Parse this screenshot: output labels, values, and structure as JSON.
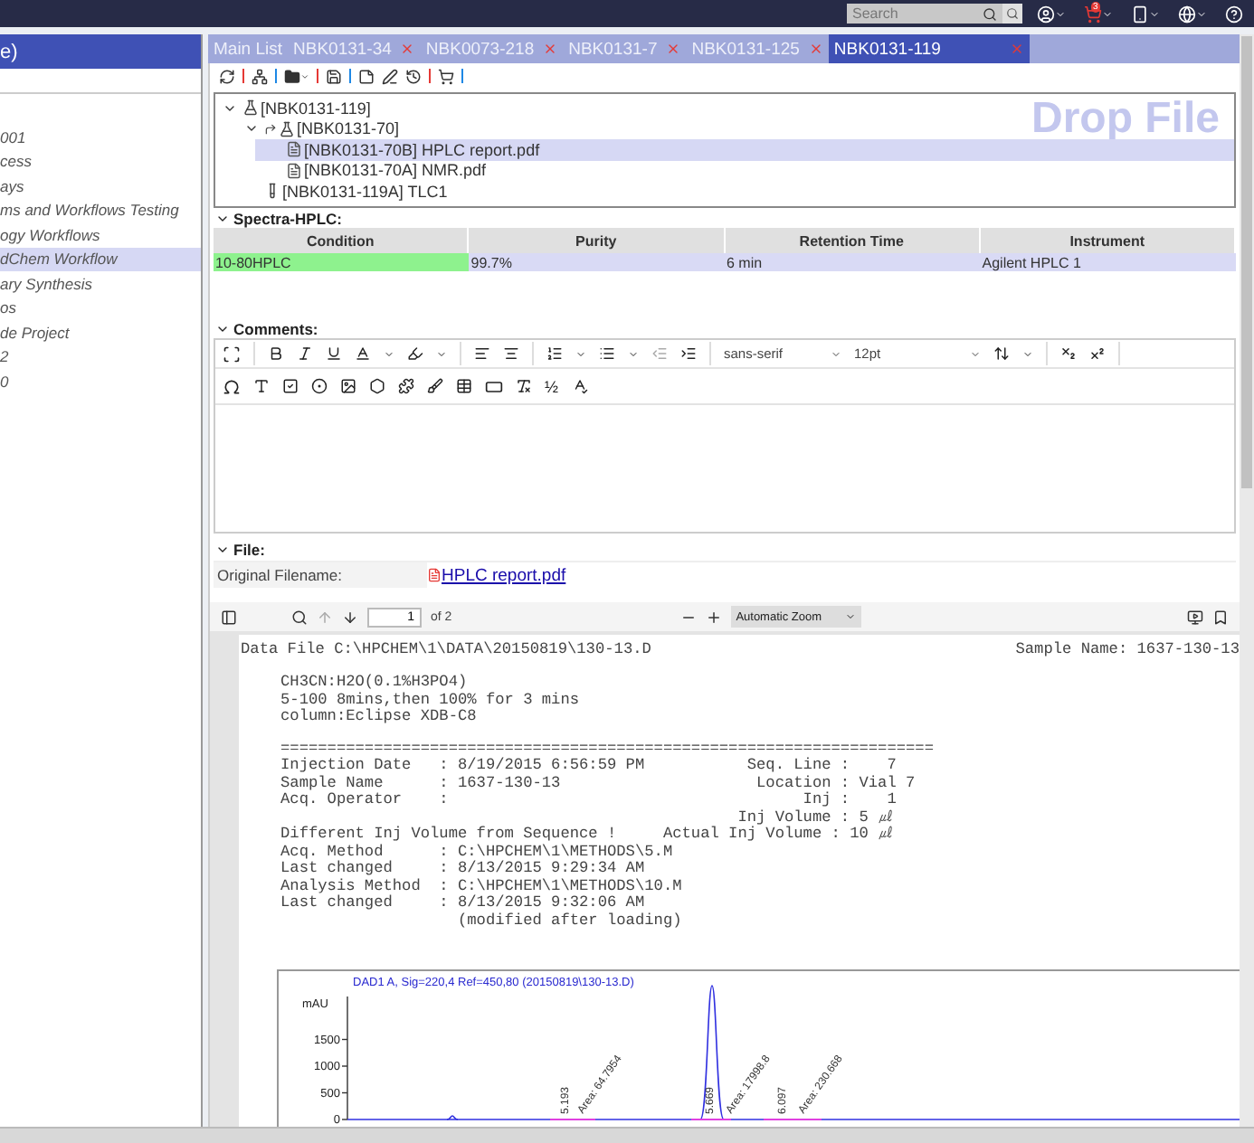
{
  "top_bar": {
    "search": {
      "placeholder": "Search"
    },
    "cart_badge": "3"
  },
  "sidebar": {
    "title": "e)",
    "items": [
      {
        "label": "001",
        "selected": false
      },
      {
        "label": "cess",
        "selected": false
      },
      {
        "label": "ays",
        "selected": false
      },
      {
        "label": "ms and Workflows Testing",
        "selected": false
      },
      {
        "label": "ogy Workflows",
        "selected": false
      },
      {
        "label": "dChem Workflow",
        "selected": true
      },
      {
        "label": "ary Synthesis",
        "selected": false
      },
      {
        "label": "os",
        "selected": false
      },
      {
        "label": "de Project",
        "selected": false
      },
      {
        "label": "2",
        "selected": false
      },
      {
        "label": "0",
        "selected": false
      }
    ]
  },
  "tabs": [
    {
      "label": "Main List",
      "closable": false,
      "selected": false
    },
    {
      "label": "NBK0131-34",
      "closable": true,
      "selected": false
    },
    {
      "label": "NBK0073-218",
      "closable": true,
      "selected": false
    },
    {
      "label": "NBK0131-7",
      "closable": true,
      "selected": false
    },
    {
      "label": "NBK0131-125",
      "closable": true,
      "selected": false
    },
    {
      "label": "NBK0131-119",
      "closable": true,
      "selected": true
    }
  ],
  "tree": {
    "drop_hint": "Drop File",
    "nodes": [
      {
        "label": "[NBK0131-119]",
        "kind": "sample",
        "expanded": true,
        "selected": false,
        "children": [
          {
            "label": "[NBK0131-70]",
            "kind": "linked-sample",
            "expanded": true,
            "selected": false,
            "children": [
              {
                "label": "[NBK0131-70B] HPLC report.pdf",
                "kind": "document",
                "selected": true
              },
              {
                "label": "[NBK0131-70A] NMR.pdf",
                "kind": "document",
                "selected": false
              }
            ]
          },
          {
            "label": "[NBK0131-119A] TLC1",
            "kind": "tube",
            "selected": false
          }
        ]
      }
    ]
  },
  "spectra": {
    "title": "Spectra-HPLC:",
    "expanded": true,
    "columns": [
      "Condition",
      "Purity",
      "Retention Time",
      "Instrument"
    ],
    "rows": [
      {
        "cells": [
          "10-80HPLC",
          "99.7%",
          "6 min",
          "Agilent HPLC 1"
        ],
        "highlight_first": true
      }
    ]
  },
  "comments": {
    "title": "Comments:",
    "expanded": true,
    "font": "sans-serif",
    "size": "12pt",
    "fraction": "½"
  },
  "file": {
    "title": "File:",
    "expanded": true,
    "label": "Original Filename:",
    "link": "HPLC report.pdf"
  },
  "pdf_viewer": {
    "page": "1",
    "page_count": "of 2",
    "zoom": "Automatic Zoom"
  },
  "document": {
    "header_left": "Data File C:\\HPCHEM\\1\\DATA\\20150819\\130-13.D",
    "header_right": "Sample Name: 1637-130-13",
    "blocks": [
      [
        "CH3CN:H2O(0.1%H3PO4)",
        "5-100 8mins,then 100% for 3 mins",
        "column:Eclipse XDB-C8"
      ],
      [
        "======================================================================",
        "Injection Date   : 8/19/2015 6:56:59 PM           Seq. Line :    7",
        "Sample Name      : 1637-130-13                     Location : Vial 7",
        "Acq. Operator    :                                      Inj :    1",
        "                                                 Inj Volume : 5 ㎕",
        "Different Inj Volume from Sequence !     Actual Inj Volume : 10 ㎕",
        "Acq. Method      : C:\\HPCHEM\\1\\METHODS\\5.M",
        "Last changed     : 8/13/2015 9:29:34 AM",
        "Analysis Method  : C:\\HPCHEM\\1\\METHODS\\10.M",
        "Last changed     : 8/13/2015 9:32:06 AM",
        "                   (modified after loading)"
      ]
    ],
    "chromatogram": {
      "title": "DAD1 A, Sig=220,4 Ref=450,80 (20150819\\130-13.D)",
      "unit": "mAU",
      "tick_labels": [
        "1500",
        "1000",
        "500",
        "0"
      ],
      "peak_labels": [
        "5.193",
        "Area: 64.7954",
        "5.669",
        "Area: 17998.8",
        "6.097",
        "Area: 230.668"
      ]
    }
  }
}
